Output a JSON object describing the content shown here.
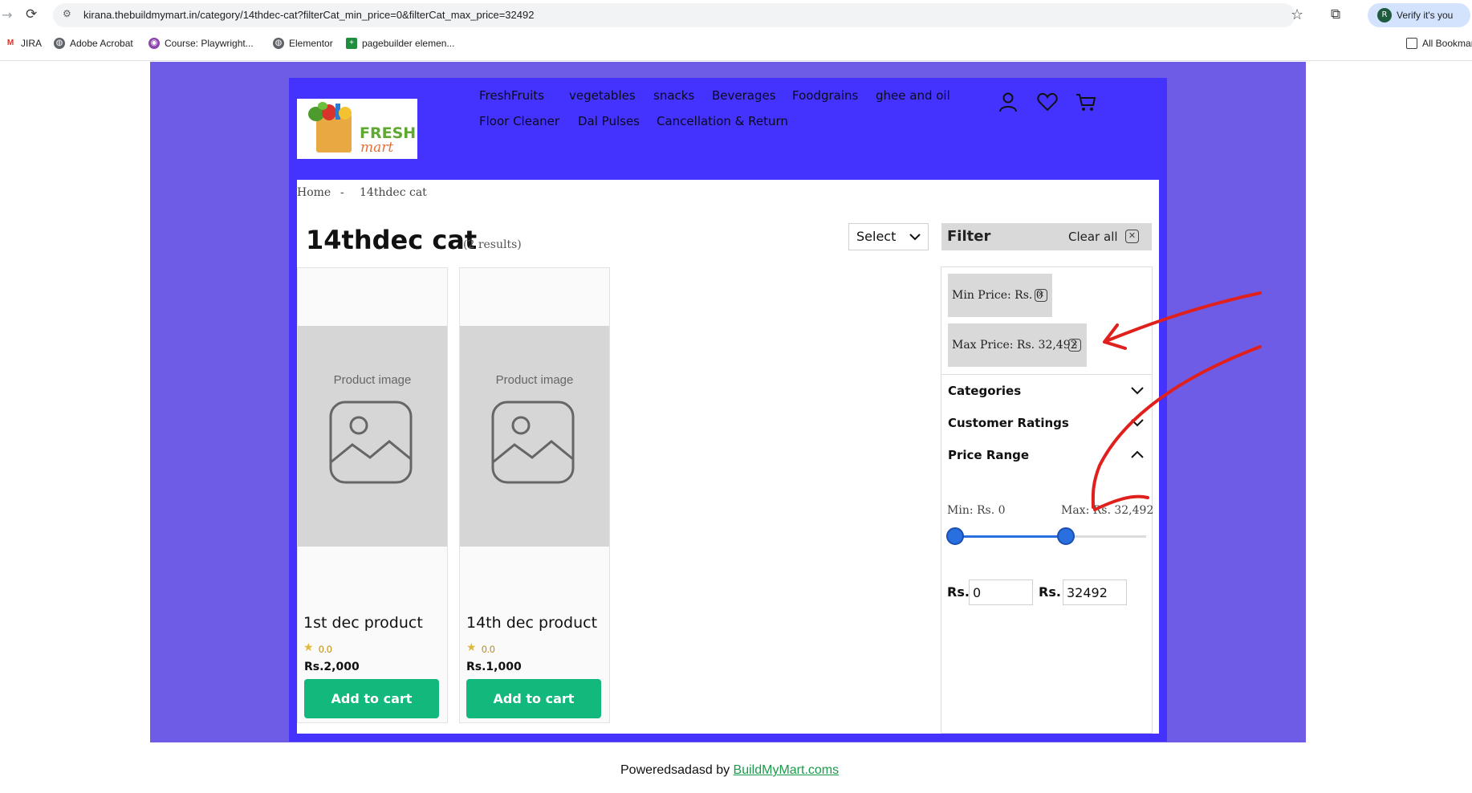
{
  "browser": {
    "url": "kirana.thebuildmymart.in/category/14thdec-cat?filterCat_min_price=0&filterCat_max_price=32492",
    "profile_label": "Verify it's you",
    "profile_initial": "R",
    "bookmarks": [
      "JIRA",
      "Adobe Acrobat",
      "Course: Playwright...",
      "Elementor",
      "pagebuilder elemen...",
      "All Bookmarks"
    ]
  },
  "header": {
    "logo_fresh": "FRESH",
    "logo_mart": "mart",
    "menu": [
      "FreshFruits",
      "vegetables",
      "snacks",
      "Beverages",
      "Foodgrains",
      "ghee and oil",
      "Floor Cleaner",
      "Dal Pulses",
      "Cancellation & Return"
    ]
  },
  "breadcrumb": {
    "home": "Home",
    "separator": "-",
    "current": "14thdec cat"
  },
  "category": {
    "title": "14thdec cat",
    "count": "(2 results)"
  },
  "sort": {
    "label": "Select"
  },
  "products": [
    {
      "image_text": "Product image",
      "name": "1st dec product",
      "rating": "0.0",
      "price": "Rs.2,000",
      "button": "Add to cart"
    },
    {
      "image_text": "Product image",
      "name": "14th dec product",
      "rating": "0.0",
      "price": "Rs.1,000",
      "button": "Add to cart"
    }
  ],
  "filter": {
    "title": "Filter",
    "clear_all": "Clear all",
    "chips": [
      "Min Price: Rs. 0",
      "Max Price: Rs. 32,492"
    ],
    "sections": [
      "Categories",
      "Customer Ratings",
      "Price Range"
    ],
    "range_min_label": "Min: Rs. 0",
    "range_max_label": "Max: Rs. 32,492",
    "slider_min_fraction": 0,
    "slider_max_fraction": 0.58,
    "rs_label": "Rs.",
    "min_value": "0",
    "max_value": "32492"
  },
  "footer": {
    "prefix": "Poweredsadasd by ",
    "link": "BuildMyMart.coms"
  },
  "colors": {
    "page_bg": "#6f5ce6",
    "site_bg": "#4433ff",
    "accent_green": "#12b87c",
    "slider_blue": "#2a6fe0",
    "annotation_red": "#e0201c"
  }
}
